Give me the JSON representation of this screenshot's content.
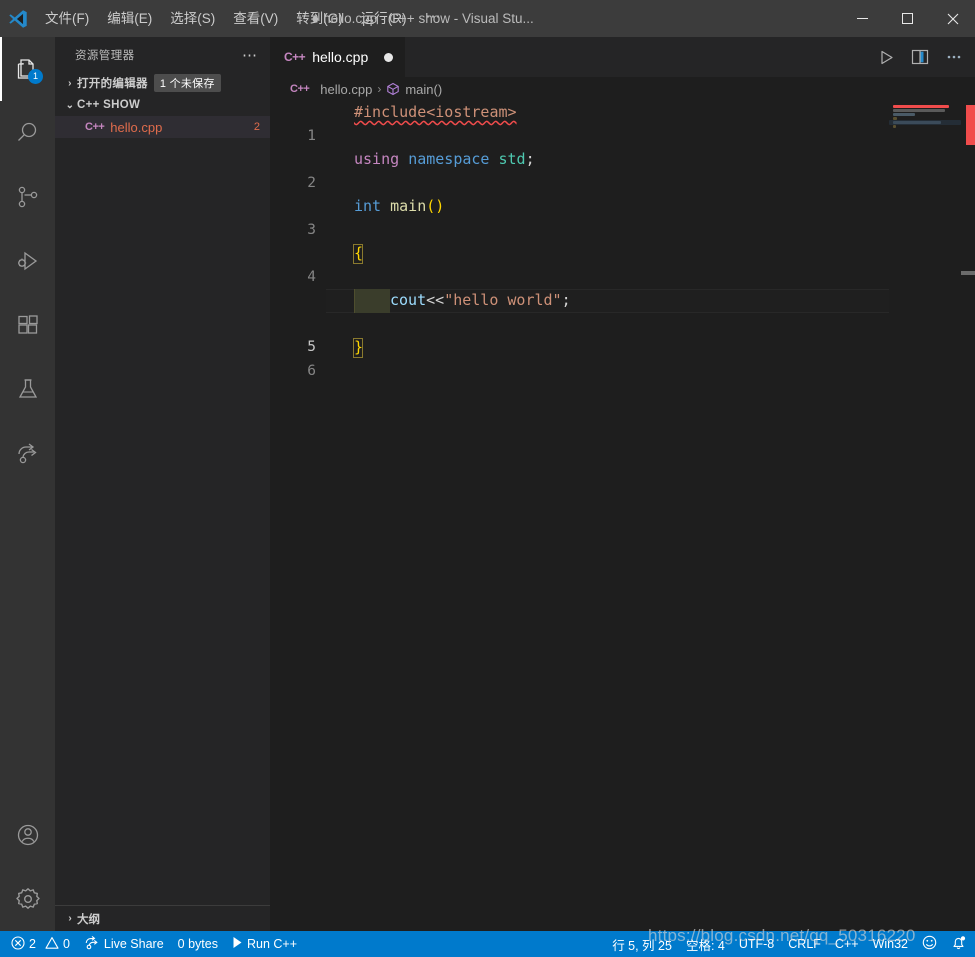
{
  "titlebar": {
    "logo_icon": "vscode-logo-icon",
    "menus": [
      {
        "label": "文件(F)",
        "name": "menu-file"
      },
      {
        "label": "编辑(E)",
        "name": "menu-edit"
      },
      {
        "label": "选择(S)",
        "name": "menu-selection"
      },
      {
        "label": "查看(V)",
        "name": "menu-view"
      },
      {
        "label": "转到(G)",
        "name": "menu-go"
      },
      {
        "label": "运行(R)",
        "name": "menu-run"
      }
    ],
    "more_label": "⋯",
    "window_title": "● hello.cpp - C++ show - Visual Stu...",
    "minimize_label": "—",
    "maximize_label": "☐",
    "close_label": "✕"
  },
  "activitybar": {
    "items": [
      {
        "name": "explorer",
        "icon": "files-icon",
        "badge": "1",
        "active": true
      },
      {
        "name": "search",
        "icon": "search-icon",
        "badge": "",
        "active": false
      },
      {
        "name": "source-control",
        "icon": "source-control-icon",
        "badge": "",
        "active": false
      },
      {
        "name": "run-and-debug",
        "icon": "run-debug-icon",
        "badge": "",
        "active": false
      },
      {
        "name": "extensions",
        "icon": "extensions-icon",
        "badge": "",
        "active": false
      },
      {
        "name": "testing",
        "icon": "beaker-icon",
        "badge": "",
        "active": false
      },
      {
        "name": "live-share",
        "icon": "live-share-icon",
        "badge": "",
        "active": false
      }
    ],
    "bottom_items": [
      {
        "name": "accounts",
        "icon": "account-icon"
      },
      {
        "name": "manage",
        "icon": "gear-icon"
      }
    ]
  },
  "sidebar": {
    "title": "资源管理器",
    "actions_label": "⋯",
    "open_editors": {
      "twisty": "›",
      "label": "打开的编辑器",
      "badge": "1 个未保存"
    },
    "folder": {
      "twisty": "⌄",
      "label": "C++ SHOW"
    },
    "files": [
      {
        "icon_label": "C++",
        "name": "hello.cpp",
        "badge": "2",
        "selected": true
      }
    ],
    "outline": {
      "twisty": "›",
      "label": "大纲"
    }
  },
  "editor": {
    "tab": {
      "icon_label": "C++",
      "title": "hello.cpp",
      "dirty": true
    },
    "actions": [
      {
        "name": "run-code-button",
        "icon": "play-icon"
      },
      {
        "name": "split-editor-button",
        "icon": "split-editor-icon"
      },
      {
        "name": "more-actions-button",
        "icon": "ellipsis-icon"
      }
    ],
    "breadcrumb": {
      "file_icon_label": "C++",
      "file": "hello.cpp",
      "separator": "›",
      "symbol_icon": "symbol-method-icon",
      "symbol": "main()"
    },
    "lines": [
      {
        "number": "1",
        "text": "#include<iostream>"
      },
      {
        "number": "2",
        "text": "using namespace std;"
      },
      {
        "number": "3",
        "text": "int main()"
      },
      {
        "number": "4",
        "text": "{"
      },
      {
        "number": "5",
        "text": "    cout<<\"hello world\";"
      },
      {
        "number": "6",
        "text": "}"
      }
    ],
    "colors": {
      "background": "#1e1e1e",
      "preprocessor": "#ce9178",
      "keyword": "#569cd6",
      "control_keyword": "#c586c0",
      "type": "#4ec9b0",
      "function": "#dcdcaa",
      "variable": "#9cdcfe",
      "string": "#ce9178",
      "bracket": "#ffd700",
      "error_squiggle": "#f14c4c"
    }
  },
  "statusbar": {
    "background": "#007acc",
    "left": [
      {
        "name": "problems",
        "icon": "error-icon",
        "errors": "2",
        "warn_icon": "warning-icon",
        "warnings": "0"
      },
      {
        "name": "live-share",
        "icon": "live-share-icon",
        "label": "Live Share"
      },
      {
        "name": "file-size",
        "label": "0 bytes"
      },
      {
        "name": "run-cpp",
        "icon": "play-icon",
        "label": "Run C++"
      }
    ],
    "right": [
      {
        "name": "cursor-position",
        "label": "行 5, 列 25"
      },
      {
        "name": "indentation",
        "label": "空格: 4"
      },
      {
        "name": "encoding",
        "label": "UTF-8"
      },
      {
        "name": "eol",
        "label": "CRLF"
      },
      {
        "name": "language-mode",
        "label": "C++"
      },
      {
        "name": "platform",
        "label": "Win32"
      },
      {
        "name": "feedback",
        "icon": "smiley-icon",
        "label": ""
      },
      {
        "name": "notifications",
        "icon": "bell-dot-icon",
        "label": ""
      }
    ]
  },
  "watermark": {
    "text": "https://blog.csdn.net/qq_50316220"
  }
}
